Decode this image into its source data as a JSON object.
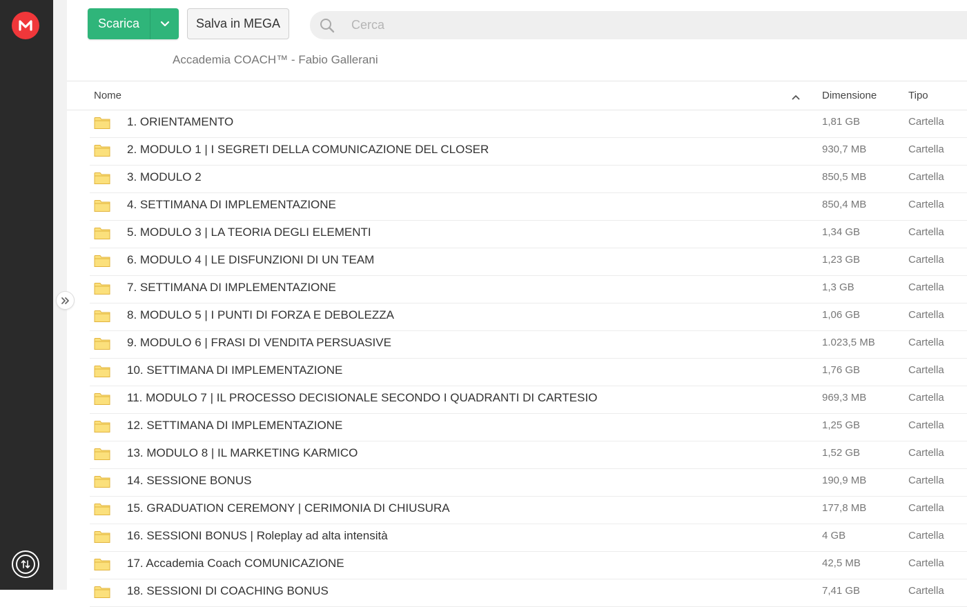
{
  "toolbar": {
    "download_label": "Scarica",
    "save_label": "Salva in MEGA"
  },
  "search": {
    "placeholder": "Cerca",
    "value": ""
  },
  "breadcrumb": "Accademia COACH™ - Fabio Gallerani",
  "table": {
    "headers": {
      "name": "Nome",
      "size": "Dimensione",
      "type": "Tipo"
    },
    "rows": [
      {
        "name": "1. ORIENTAMENTO",
        "size": "1,81 GB",
        "type": "Cartella"
      },
      {
        "name": "2. MODULO 1 | I SEGRETI DELLA COMUNICAZIONE DEL CLOSER",
        "size": "930,7 MB",
        "type": "Cartella"
      },
      {
        "name": "3. MODULO 2",
        "size": "850,5 MB",
        "type": "Cartella"
      },
      {
        "name": "4. SETTIMANA DI IMPLEMENTAZIONE",
        "size": "850,4 MB",
        "type": "Cartella"
      },
      {
        "name": "5. MODULO 3 | LA TEORIA DEGLI ELEMENTI",
        "size": "1,34 GB",
        "type": "Cartella"
      },
      {
        "name": "6. MODULO 4 | LE DISFUNZIONI DI UN TEAM",
        "size": "1,23 GB",
        "type": "Cartella"
      },
      {
        "name": "7. SETTIMANA DI IMPLEMENTAZIONE",
        "size": "1,3 GB",
        "type": "Cartella"
      },
      {
        "name": "8. MODULO 5 | I PUNTI DI FORZA E DEBOLEZZA",
        "size": "1,06 GB",
        "type": "Cartella"
      },
      {
        "name": "9. MODULO 6 | FRASI DI VENDITA PERSUASIVE",
        "size": "1.023,5 MB",
        "type": "Cartella"
      },
      {
        "name": "10. SETTIMANA DI IMPLEMENTAZIONE",
        "size": "1,76 GB",
        "type": "Cartella"
      },
      {
        "name": "11. MODULO 7 | IL PROCESSO DECISIONALE SECONDO I QUADRANTI DI CARTESIO",
        "size": "969,3 MB",
        "type": "Cartella"
      },
      {
        "name": "12. SETTIMANA DI IMPLEMENTAZIONE",
        "size": "1,25 GB",
        "type": "Cartella"
      },
      {
        "name": "13. MODULO 8 | IL MARKETING KARMICO",
        "size": "1,52 GB",
        "type": "Cartella"
      },
      {
        "name": "14. SESSIONE BONUS",
        "size": "190,9 MB",
        "type": "Cartella"
      },
      {
        "name": "15. GRADUATION CEREMONY | CERIMONIA DI CHIUSURA",
        "size": "177,8 MB",
        "type": "Cartella"
      },
      {
        "name": "16. SESSIONI BONUS | Roleplay ad alta intensità",
        "size": "4 GB",
        "type": "Cartella"
      },
      {
        "name": "17. Accademia Coach COMUNICAZIONE",
        "size": "42,5 MB",
        "type": "Cartella"
      },
      {
        "name": "18. SESSIONI DI COACHING BONUS",
        "size": "7,41 GB",
        "type": "Cartella"
      }
    ]
  },
  "icons": {
    "logo": "mega-logo-icon",
    "transfer": "transfer-manager-icon",
    "expand": "expand-sidebar-icon",
    "search": "search-icon",
    "dropdown": "chevron-down-icon",
    "sort": "sort-ascending-icon",
    "folder": "folder-icon"
  },
  "colors": {
    "accent_green": "#2fb57a",
    "brand_red": "#f0373a",
    "rail": "#2a2a2a",
    "folder_fill": "#fbe07c",
    "folder_stroke": "#e2b33c"
  }
}
